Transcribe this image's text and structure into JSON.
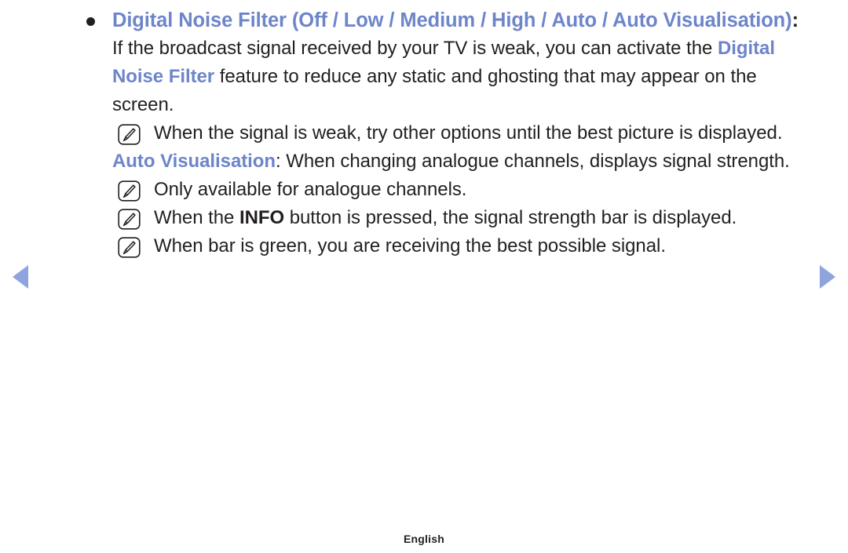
{
  "nav": {
    "prev_icon": "triangle-left-icon",
    "next_icon": "triangle-right-icon",
    "arrow_color": "#8fa3dd"
  },
  "colors": {
    "accent_blue": "#6d85ca",
    "body_text": "#231f20",
    "background": "#ffffff"
  },
  "section": {
    "bullet_glyph": "•",
    "heading_text": "Digital Noise Filter (Off / Low / Medium / High / Auto / Auto Visualisation)",
    "heading_colon": ":",
    "paragraph_1": {
      "line_1": "If the broadcast signal received by your TV is weak, you can activate the",
      "line_2_blue": "Digital Noise Filter",
      "line_2_rest": " feature to reduce any static and ghosting that may appear",
      "line_3": "on the screen."
    },
    "notes_group_1": [
      {
        "icon": "note-pencil-icon",
        "text": "When the signal is weak, try other options until the best picture is displayed."
      }
    ],
    "paragraph_2": {
      "label_blue": "Auto Visualisation",
      "colon": ":",
      "text": " When changing analogue channels, displays signal strength."
    },
    "notes_group_2": [
      {
        "icon": "note-pencil-icon",
        "text_before": "Only available for analogue channels.",
        "bold": "",
        "text_after": ""
      },
      {
        "icon": "note-pencil-icon",
        "text_before": "When the ",
        "bold": "INFO",
        "text_after": " button is pressed, the signal strength bar is displayed."
      },
      {
        "icon": "note-pencil-icon",
        "text_before": "When bar is green, you are receiving the best possible signal.",
        "bold": "",
        "text_after": ""
      }
    ]
  },
  "footer": {
    "language": "English"
  }
}
